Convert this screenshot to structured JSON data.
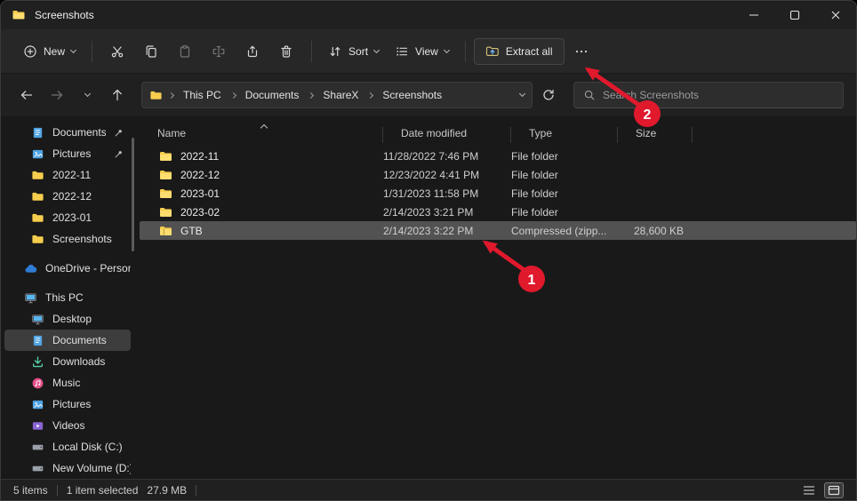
{
  "window": {
    "title": "Screenshots"
  },
  "toolbar": {
    "new_label": "New",
    "sort_label": "Sort",
    "view_label": "View",
    "extract_label": "Extract all"
  },
  "addressbar": {
    "crumbs": [
      "This PC",
      "Documents",
      "ShareX",
      "Screenshots"
    ],
    "search_placeholder": "Search Screenshots"
  },
  "sidebar": {
    "quick": [
      {
        "label": "Documents"
      },
      {
        "label": "Pictures"
      },
      {
        "label": "2022-11"
      },
      {
        "label": "2022-12"
      },
      {
        "label": "2023-01"
      },
      {
        "label": "Screenshots"
      }
    ],
    "onedrive_label": "OneDrive - Personal",
    "thispc_label": "This PC",
    "pc_items": [
      {
        "label": "Desktop"
      },
      {
        "label": "Documents"
      },
      {
        "label": "Downloads"
      },
      {
        "label": "Music"
      },
      {
        "label": "Pictures"
      },
      {
        "label": "Videos"
      },
      {
        "label": "Local Disk (C:)"
      },
      {
        "label": "New Volume (D:)"
      }
    ]
  },
  "filelist": {
    "columns": [
      "Name",
      "Date modified",
      "Type",
      "Size"
    ],
    "rows": [
      {
        "name": "2022-11",
        "date": "11/28/2022 7:46 PM",
        "type": "File folder",
        "size": ""
      },
      {
        "name": "2022-12",
        "date": "12/23/2022 4:41 PM",
        "type": "File folder",
        "size": ""
      },
      {
        "name": "2023-01",
        "date": "1/31/2023 11:58 PM",
        "type": "File folder",
        "size": ""
      },
      {
        "name": "2023-02",
        "date": "2/14/2023 3:21 PM",
        "type": "File folder",
        "size": ""
      },
      {
        "name": "GTB",
        "date": "2/14/2023 3:22 PM",
        "type": "Compressed (zipp...",
        "size": "28,600 KB"
      }
    ]
  },
  "statusbar": {
    "count": "5 items",
    "selection": "1 item selected",
    "size": "27.9 MB"
  },
  "annotations": {
    "badge1": "1",
    "badge2": "2"
  },
  "colors": {
    "accent_red": "#e0192d",
    "folder_yellow": "#f7cd4e",
    "selection_gray": "#525252"
  }
}
